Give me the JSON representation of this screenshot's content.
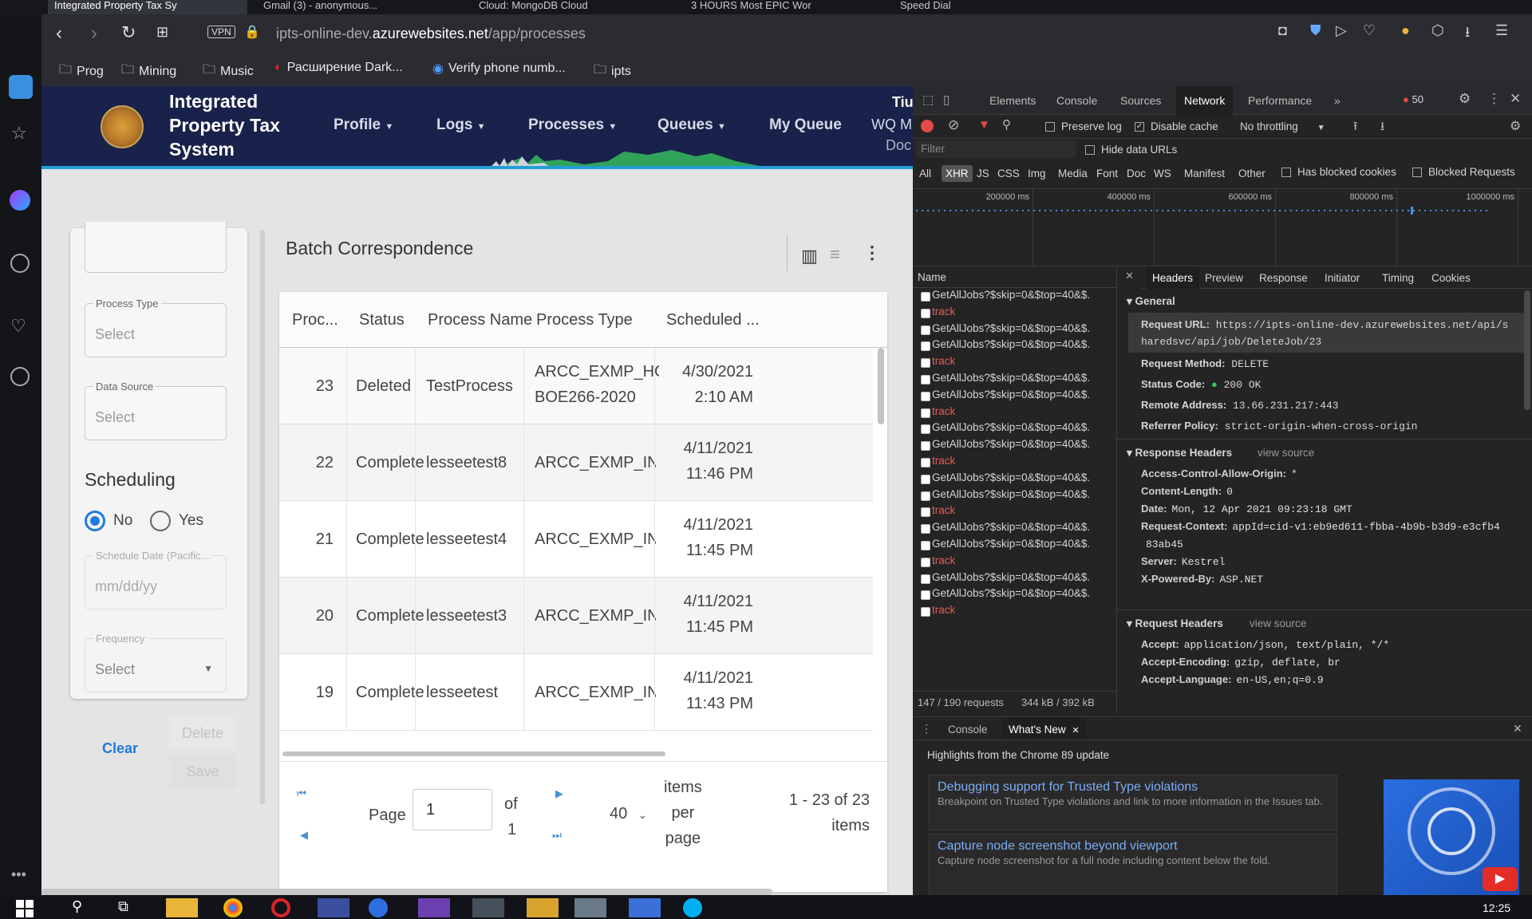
{
  "browser": {
    "tabs": [
      {
        "label": "Integrated Property Tax Sy",
        "active": true
      },
      {
        "label": "Gmail (3) - anonymous...",
        "active": false
      },
      {
        "label": "Cloud: MongoDB Cloud",
        "active": false
      },
      {
        "label": "3 HOURS Most EPIC Wor",
        "active": false
      },
      {
        "label": "Speed Dial",
        "active": false
      }
    ],
    "vpn_label": "VPN",
    "url_prefix": "ipts-online-dev.",
    "url_domain": "azurewebsites.net",
    "url_path": "/app/processes",
    "bookmarks": [
      {
        "label": "Prog",
        "icon": "folder-icon"
      },
      {
        "label": "Mining",
        "icon": "folder-icon"
      },
      {
        "label": "Music",
        "icon": "folder-icon"
      },
      {
        "label": "Расширение Dark...",
        "icon": "extension-icon"
      },
      {
        "label": "Verify phone numb...",
        "icon": "verify-icon"
      },
      {
        "label": "ipts",
        "icon": "folder-icon"
      }
    ]
  },
  "app": {
    "title_line1": "Integrated",
    "title_line2": "Property Tax",
    "title_line3": "System",
    "nav": [
      "Profile",
      "Logs",
      "Processes",
      "Queues",
      "My Queue",
      "WQ M"
    ],
    "nav_extra_top": "Tiu",
    "nav_extra_bottom": "Doc",
    "filters": {
      "process_type_label": "Process Type",
      "process_type_value": "Select",
      "data_source_label": "Data Source",
      "data_source_value": "Select",
      "scheduling_heading": "Scheduling",
      "radio_no": "No",
      "radio_yes": "Yes",
      "schedule_date_label": "Schedule Date (Pacific...",
      "schedule_date_placeholder": "mm/dd/yy",
      "frequency_label": "Frequency",
      "frequency_value": "Select",
      "clear_label": "Clear",
      "delete_label": "Delete",
      "save_label": "Save"
    },
    "grid": {
      "title": "Batch Correspondence",
      "columns": [
        "Proc...",
        "Status",
        "Process Name",
        "Process Type",
        "Scheduled ..."
      ],
      "rows": [
        {
          "id": "23",
          "status": "Deleted",
          "name": "TestProcess",
          "type1": "ARCC_EXMP_HOX-",
          "type2": "BOE266-2020",
          "date": "4/30/2021",
          "time": "2:10 AM"
        },
        {
          "id": "22",
          "status": "Complete",
          "name": "lesseetest8",
          "type1": "ARCC_EXMP_INX_Le",
          "type2": "",
          "date": "4/11/2021",
          "time": "11:46 PM"
        },
        {
          "id": "21",
          "status": "Complete",
          "name": "lesseetest4",
          "type1": "ARCC_EXMP_INX_Le",
          "type2": "",
          "date": "4/11/2021",
          "time": "11:45 PM"
        },
        {
          "id": "20",
          "status": "Complete",
          "name": "lesseetest3",
          "type1": "ARCC_EXMP_INX_Le",
          "type2": "",
          "date": "4/11/2021",
          "time": "11:45 PM"
        },
        {
          "id": "19",
          "status": "Complete",
          "name": "lesseetest",
          "type1": "ARCC_EXMP_INX_Le",
          "type2": "",
          "date": "4/11/2021",
          "time": "11:43 PM"
        }
      ],
      "pager": {
        "page_label": "Page",
        "page_value": "1",
        "of_label": "of",
        "total_pages": "1",
        "page_size": "40",
        "items_line1": "items",
        "items_line2": "per",
        "items_line3": "page",
        "range_line1": "1 - 23 of 23",
        "range_line2": "items"
      }
    }
  },
  "devtools": {
    "tabs": [
      "Elements",
      "Console",
      "Sources",
      "Network",
      "Performance"
    ],
    "active_tab": "Network",
    "error_count": "50",
    "preserve_log": "Preserve log",
    "disable_cache": "Disable cache",
    "throttling": "No throttling",
    "filter_placeholder": "Filter",
    "hide_data_urls": "Hide data URLs",
    "types": [
      "All",
      "XHR",
      "JS",
      "CSS",
      "Img",
      "Media",
      "Font",
      "Doc",
      "WS",
      "Manifest",
      "Other"
    ],
    "has_blocked_cookies": "Has blocked cookies",
    "blocked_requests": "Blocked Requests",
    "timeline_ticks": [
      "200000 ms",
      "400000 ms",
      "600000 ms",
      "800000 ms",
      "1000000 ms"
    ],
    "name_header": "Name",
    "requests": [
      "GetAllJobs?$skip=0&$top=40&$.",
      "track",
      "GetAllJobs?$skip=0&$top=40&$.",
      "GetAllJobs?$skip=0&$top=40&$.",
      "track",
      "GetAllJobs?$skip=0&$top=40&$.",
      "GetAllJobs?$skip=0&$top=40&$.",
      "track",
      "GetAllJobs?$skip=0&$top=40&$.",
      "GetAllJobs?$skip=0&$top=40&$.",
      "track",
      "GetAllJobs?$skip=0&$top=40&$.",
      "GetAllJobs?$skip=0&$top=40&$.",
      "track",
      "GetAllJobs?$skip=0&$top=40&$.",
      "GetAllJobs?$skip=0&$top=40&$.",
      "track",
      "GetAllJobs?$skip=0&$top=40&$.",
      "GetAllJobs?$skip=0&$top=40&$.",
      "track"
    ],
    "summary_requests": "147 / 190 requests",
    "summary_size": "344 kB / 392 kB",
    "detail_tabs": [
      "Headers",
      "Preview",
      "Response",
      "Initiator",
      "Timing",
      "Cookies"
    ],
    "general_label": "General",
    "request_url_key": "Request URL:",
    "request_url_val1": "https://ipts-online-dev.azurewebsites.net/api/s",
    "request_url_val2": "haredsvc/api/job/DeleteJob/23",
    "request_method_key": "Request Method:",
    "request_method_val": "DELETE",
    "status_code_key": "Status Code:",
    "status_code_val": "200 OK",
    "remote_address_key": "Remote Address:",
    "remote_address_val": "13.66.231.217:443",
    "referrer_key": "Referrer Policy:",
    "referrer_val": "strict-origin-when-cross-origin",
    "response_headers_label": "Response Headers",
    "view_source": "view source",
    "resp_h": [
      {
        "k": "Access-Control-Allow-Origin:",
        "v": "*"
      },
      {
        "k": "Content-Length:",
        "v": "0"
      },
      {
        "k": "Date:",
        "v": "Mon, 12 Apr 2021 09:23:18 GMT"
      },
      {
        "k": "Request-Context:",
        "v": "appId=cid-v1:eb9ed611-fbba-4b9b-b3d9-e3cfb4"
      },
      {
        "k": "",
        "v": "83ab45"
      },
      {
        "k": "Server:",
        "v": "Kestrel"
      },
      {
        "k": "X-Powered-By:",
        "v": "ASP.NET"
      }
    ],
    "request_headers_label": "Request Headers",
    "req_h": [
      {
        "k": "Accept:",
        "v": "application/json, text/plain, */*"
      },
      {
        "k": "Accept-Encoding:",
        "v": "gzip, deflate, br"
      },
      {
        "k": "Accept-Language:",
        "v": "en-US,en;q=0.9"
      }
    ],
    "drawer_tabs": [
      "Console",
      "What's New"
    ],
    "highlights": "Highlights from the Chrome 89 update",
    "news": [
      {
        "title": "Debugging support for Trusted Type violations",
        "body": "Breakpoint on Trusted Type violations and link to more information in the Issues tab."
      },
      {
        "title": "Capture node screenshot beyond viewport",
        "body": "Capture node screenshot for a full node including content below the fold."
      }
    ]
  },
  "taskbar": {
    "time": "12:25"
  }
}
